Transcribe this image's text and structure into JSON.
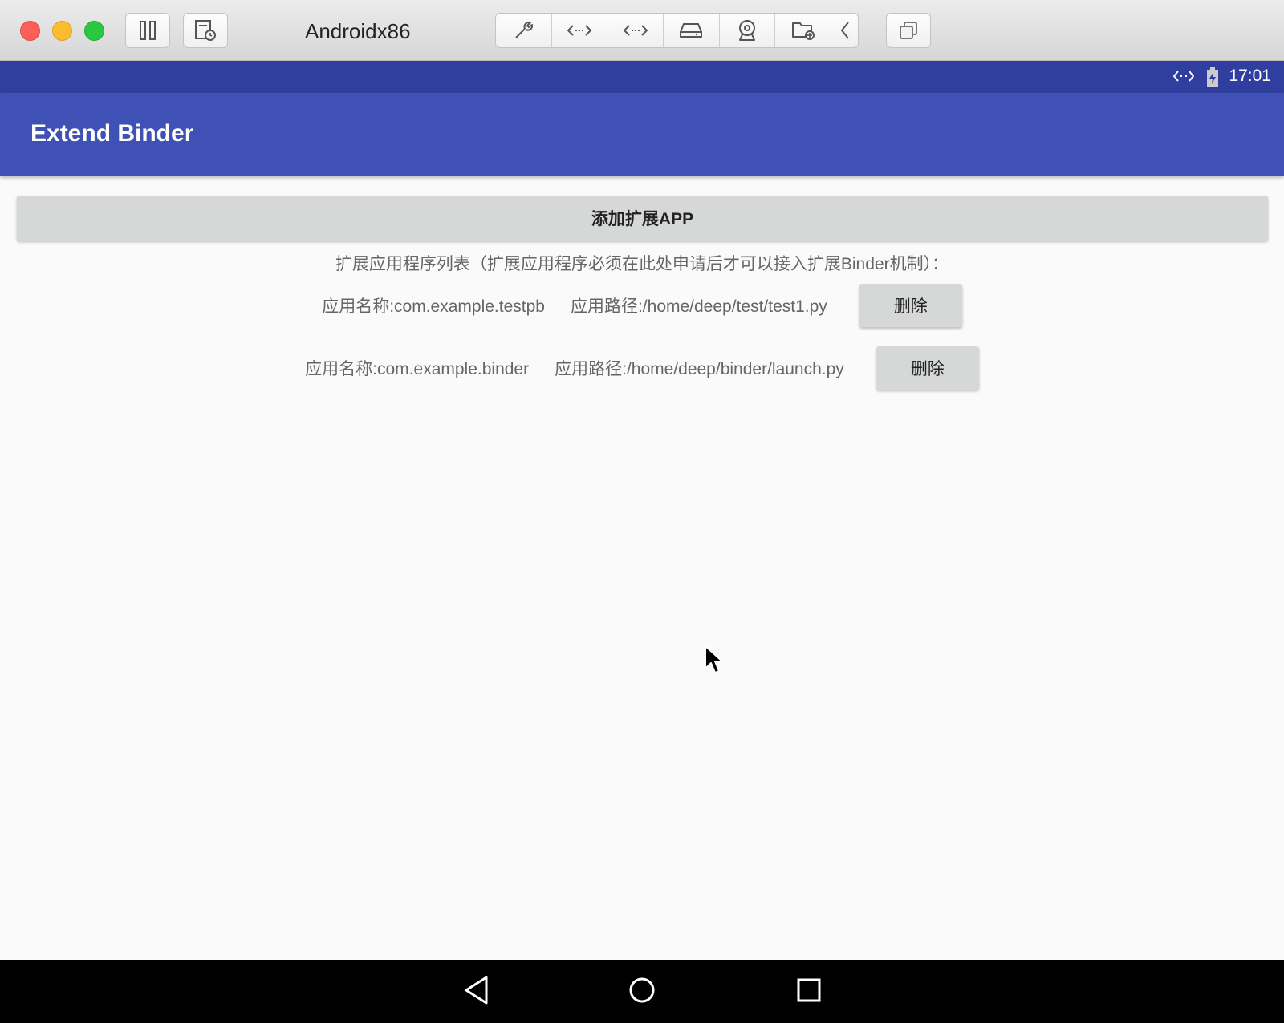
{
  "window": {
    "title": "Androidx86",
    "toolbar_icons": [
      "pause-icon",
      "snapshot-icon",
      "wrench-icon",
      "code-arrows-icon",
      "code-arrows-icon",
      "hard-drive-icon",
      "webcam-icon",
      "shared-folder-icon",
      "chevron-left-icon",
      "copy-window-icon"
    ]
  },
  "statusbar": {
    "time": "17:01",
    "icons": [
      "code-arrows-icon",
      "battery-charging-icon"
    ]
  },
  "appbar": {
    "title": "Extend Binder"
  },
  "main": {
    "add_button_label": "添加扩展APP",
    "list_header": "扩展应用程序列表（扩展应用程序必须在此处申请后才可以接入扩展Binder机制）：",
    "apps": [
      {
        "name": "应用名称:com.example.testpb",
        "path": "应用路径:/home/deep/test/test1.py",
        "delete_label": "删除"
      },
      {
        "name": "应用名称:com.example.binder",
        "path": "应用路径:/home/deep/binder/launch.py",
        "delete_label": "删除"
      }
    ]
  },
  "navbar": {
    "keys": [
      "back-icon",
      "home-icon",
      "recents-icon"
    ]
  },
  "colors": {
    "primary": "#3f51b5",
    "primary_dark": "#303f9f",
    "background": "#fafafa",
    "button": "#d6d7d7"
  }
}
